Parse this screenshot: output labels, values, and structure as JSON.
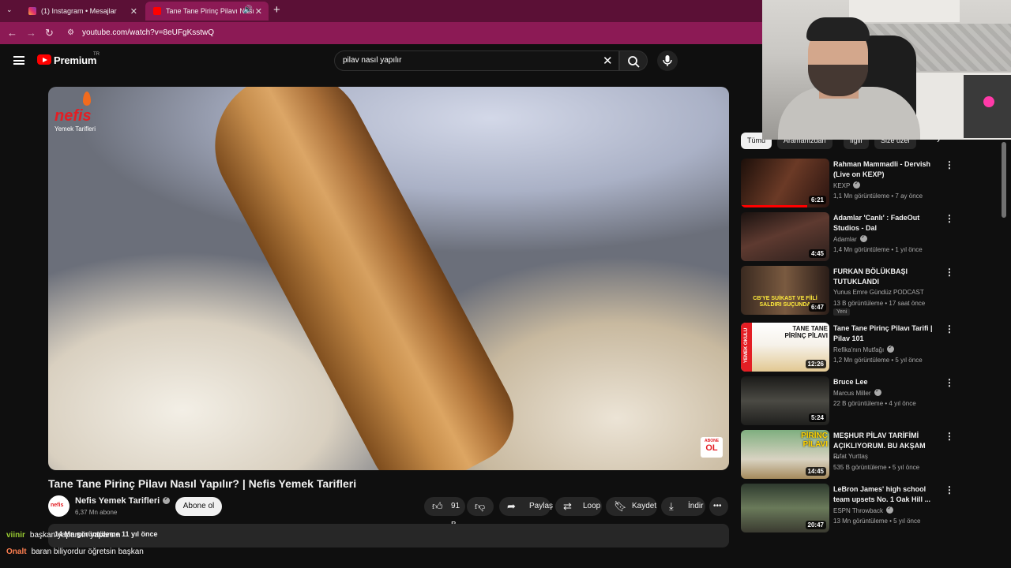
{
  "browser": {
    "tabs": [
      {
        "label": "(1) Instagram • Mesajlar",
        "active": false
      },
      {
        "label": "Tane Tane Pirinç Pilavı Nası",
        "active": true
      }
    ],
    "url": "youtube.com/watch?v=8eUFgKsstwQ"
  },
  "youtube": {
    "brand": "Premium",
    "region": "TR",
    "search_value": "pilav nasıl yapılır"
  },
  "video": {
    "title": "Tane Tane Pirinç Pilavı Nasıl Yapılır? | Nefis Yemek Tarifleri",
    "overlay_logo_word": "nefis",
    "overlay_logo_sub": "Yemek Tarifleri",
    "badge_top": "ABONE",
    "badge_bottom": "OL",
    "channel": "Nefis Yemek Tarifleri",
    "channel_avatar_text": "nefis",
    "subscribers": "6,37 Mn abone",
    "subscribe_label": "Abone ol",
    "likes": "91 B",
    "share_label": "Paylaş",
    "loop_label": "Loop",
    "save_label": "Kaydet",
    "download_label": "İndir",
    "views_age": "14 Mn görüntüleme  11 yıl önce"
  },
  "chips": [
    "Tümü",
    "Aramanızdan",
    "İlgili",
    "Size özel"
  ],
  "recommendations": [
    {
      "title": "Rahman Mammadli - Dervish (Live on KEXP)",
      "channel": "KEXP",
      "verified": true,
      "meta": "1,1 Mn görüntüleme • 7 ay önce",
      "duration": "6:21",
      "progress": 0.75,
      "thumb_color": "#4a2a1e"
    },
    {
      "title": "Adamlar 'Canlı' : FadeOut Studios - Dal",
      "channel": "Adamlar",
      "verified": true,
      "meta": "1,4 Mn görüntüleme • 1 yıl önce",
      "duration": "4:45",
      "progress": 0,
      "thumb_color": "#2c1d1a"
    },
    {
      "title": "FURKAN BÖLÜKBAŞI TUTUKLANDI",
      "channel": "Yunus Emre Gündüz PODCAST",
      "verified": false,
      "meta": "13 B görüntüleme • 17 saat önce",
      "badge": "Yeni",
      "duration": "6:47",
      "progress": 0,
      "thumb_color": "#3b2b22",
      "thumb_caption": "CB'YE SUİKAST VE FİİLİ SALDIRI SUÇUNDA"
    },
    {
      "title": "Tane Tane Pirinç Pilavı Tarifi | Pilav 101",
      "channel": "Refika'nın Mutfağı",
      "verified": true,
      "meta": "1,2 Mn görüntüleme • 5 yıl önce",
      "duration": "12:26",
      "progress": 0,
      "thumb_color": "#f4f1ea",
      "thumb_caption": "TANE TANE PİRİNÇ PİLAVI",
      "thumb_side": "YEMEK OKULU"
    },
    {
      "title": "Bruce Lee",
      "channel": "Marcus Miller",
      "verified": true,
      "meta": "22 B görüntüleme • 4 yıl önce",
      "duration": "5:24",
      "progress": 0,
      "thumb_color": "#2a2a28"
    },
    {
      "title": "MEŞHUR PİLAV TARİFİMİ AÇIKLIYORUM. BU AKŞAM ...",
      "channel": "Rıfat Yurttaş",
      "verified": false,
      "meta": "535 B görüntüleme • 5 yıl önce",
      "duration": "14:45",
      "progress": 0,
      "thumb_color": "#6a8a6a",
      "thumb_caption": "PİRİNÇ PİLAVI"
    },
    {
      "title": "LeBron James' high school team upsets No. 1 Oak Hill ...",
      "channel": "ESPN Throwback",
      "verified": true,
      "meta": "13 Mn görüntüleme • 5 yıl önce",
      "duration": "20:47",
      "progress": 0,
      "thumb_color": "#3a4a3a"
    }
  ],
  "chat": [
    {
      "user": "viinir",
      "user_color": "#9acd32",
      "text": "başkan yaparsın yaparsın"
    },
    {
      "user": "Onalt",
      "user_color": "#ff7f50",
      "text": "baran biliyordur öğretsin başkan"
    }
  ],
  "colors": {
    "tab_bar": "#5b1036",
    "address_bar": "#8c1a55",
    "yt_red": "#ff0000",
    "background": "#0f0f0f"
  }
}
